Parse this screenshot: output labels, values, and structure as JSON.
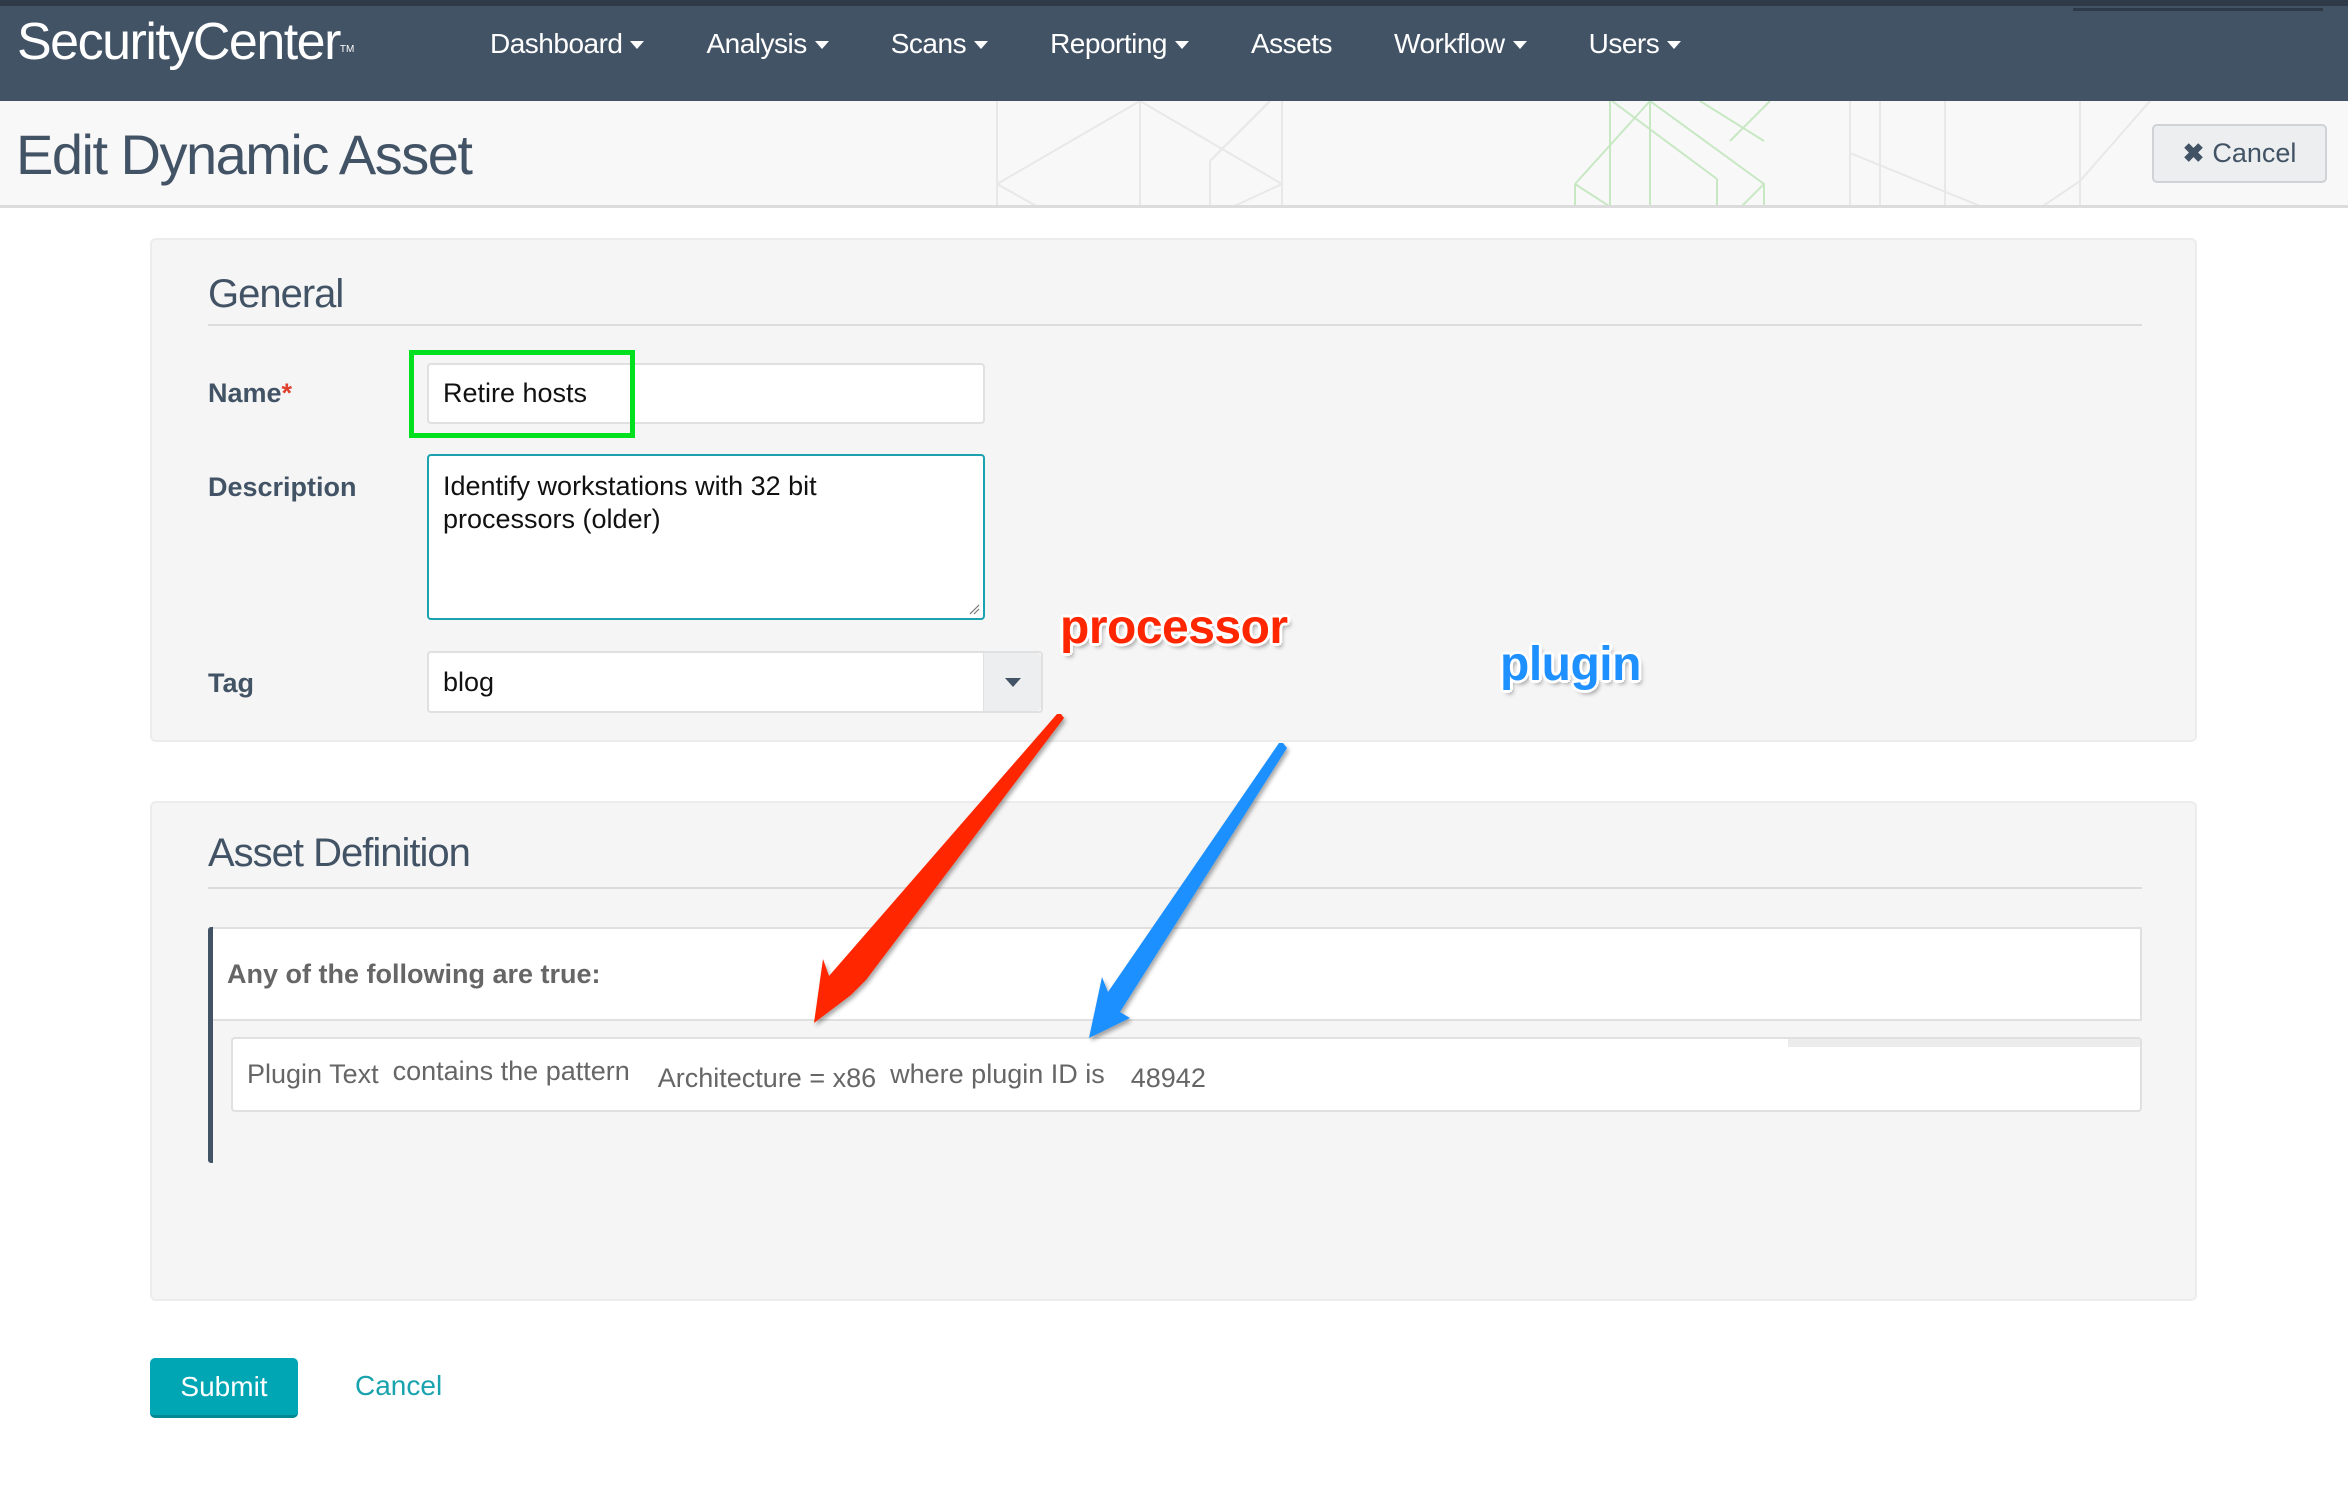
{
  "app": {
    "logo": "SecurityCenter",
    "logo_tm": "TM"
  },
  "nav": {
    "items": [
      {
        "label": "Dashboard",
        "has_menu": true
      },
      {
        "label": "Analysis",
        "has_menu": true
      },
      {
        "label": "Scans",
        "has_menu": true
      },
      {
        "label": "Reporting",
        "has_menu": true
      },
      {
        "label": "Assets",
        "has_menu": false
      },
      {
        "label": "Workflow",
        "has_menu": true
      },
      {
        "label": "Users",
        "has_menu": true
      }
    ]
  },
  "header": {
    "title": "Edit Dynamic Asset",
    "cancel_label": "Cancel",
    "cancel_icon": "close-icon"
  },
  "general": {
    "heading": "General",
    "name_label": "Name",
    "name_required_marker": "*",
    "name_value": "Retire hosts",
    "description_label": "Description",
    "description_value": "Identify workstations with 32 bit processors (older)",
    "tag_label": "Tag",
    "tag_value": "blog"
  },
  "asset_definition": {
    "heading": "Asset Definition",
    "group_condition": "Any of the following are true:",
    "rule": {
      "field": "Plugin Text",
      "operator": "contains the pattern",
      "pattern": "Architecture = x86",
      "qualifier": "where plugin ID is",
      "plugin_id": "48942"
    }
  },
  "actions": {
    "submit_label": "Submit",
    "cancel_label": "Cancel"
  },
  "annotations": {
    "processor_label": "processor",
    "processor_color": "#ff2600",
    "plugin_label": "plugin",
    "plugin_color": "#1e90ff",
    "highlight_color": "#00e01e"
  },
  "colors": {
    "nav_bg": "#435366",
    "accent": "#00a6b4",
    "text_primary": "#435366"
  }
}
